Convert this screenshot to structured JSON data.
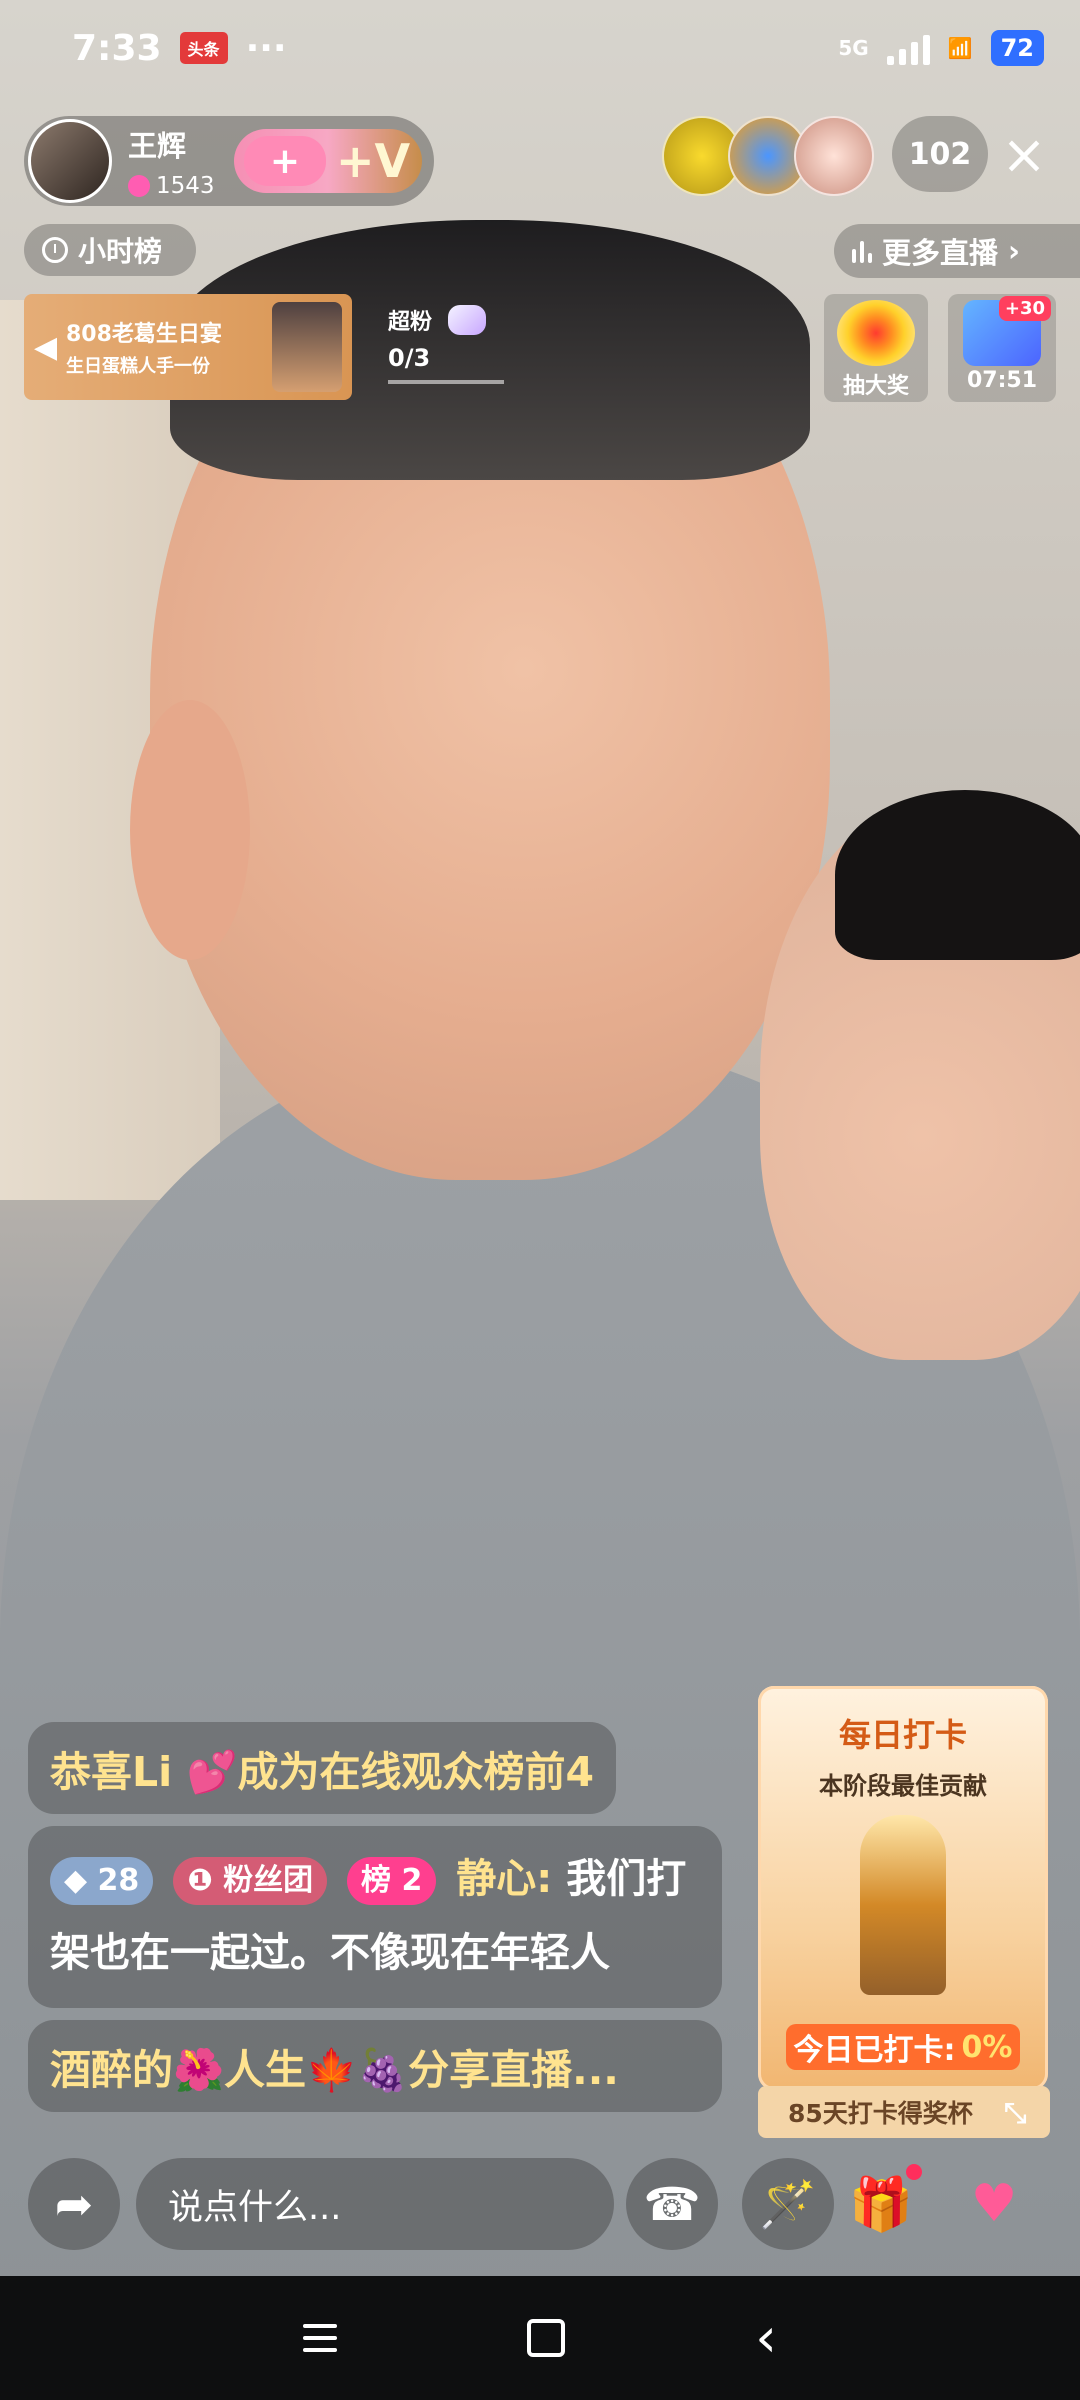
{
  "status_bar": {
    "time": "7:33",
    "app_badge": "头条",
    "more": "···",
    "network": "5G",
    "wifi": "Wi-Fi",
    "battery": "72"
  },
  "host": {
    "name": "王辉",
    "likes": "1543",
    "follow_plus": "+",
    "follow_v": "+V"
  },
  "viewers": {
    "count": "102",
    "close": "×"
  },
  "hour_rank": {
    "label": "小时榜"
  },
  "more_live": {
    "label": "更多直播",
    "arrow": "›"
  },
  "promo": {
    "arrow": "◀",
    "line1": "808老葛生日宴",
    "line2": "生日蛋糕人手一份"
  },
  "superfan": {
    "label": "超粉",
    "count": "0/3"
  },
  "lottery": {
    "label": "抽大奖"
  },
  "timer_widget": {
    "badge": "+30",
    "time": "07:51"
  },
  "chat": {
    "messages": [
      {
        "text": "恭喜Li 💕成为在线观众榜前4"
      },
      {
        "badge_diamond": "28",
        "badge_fans": "粉丝团",
        "badge_rank": "榜 2",
        "name": "静心:",
        "content": "我们打架也在一起过。不像现在年轻人"
      },
      {
        "text": "酒醉的🌺人生🍁🍇分享直播..."
      }
    ]
  },
  "checkin": {
    "title": "每日打卡",
    "subtitle": "本阶段最佳贡献",
    "progress_label": "今日已打卡:",
    "progress_value": "0%",
    "reward_text": "85天打卡得奖杯",
    "progress_percent": 0
  },
  "bottom_bar": {
    "input_placeholder": "说点什么..."
  }
}
